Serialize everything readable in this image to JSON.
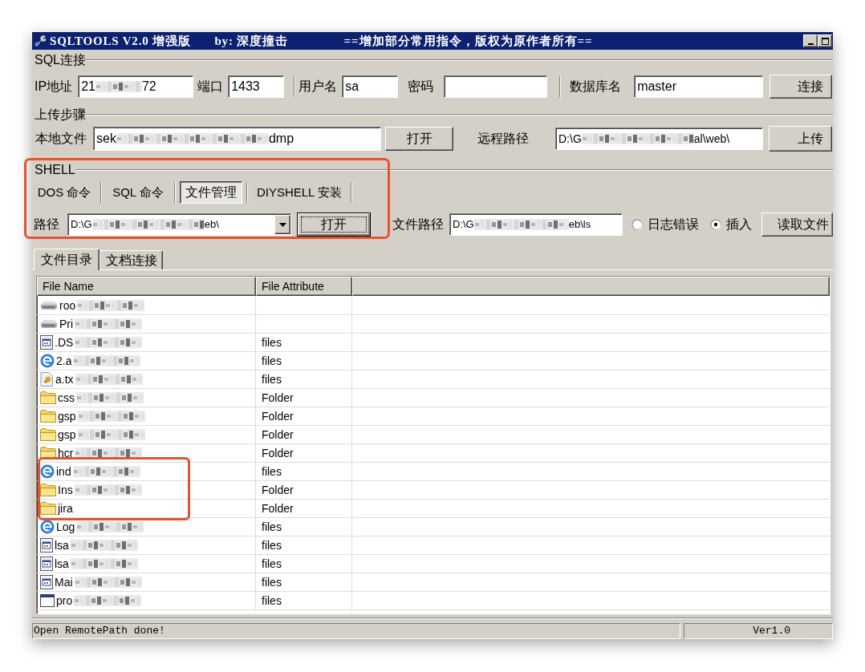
{
  "window": {
    "title": "SQLTOOLS V2.0 增强版",
    "author": "by: 深度撞击",
    "notice": "==增加部分常用指令，版权为原作者所有=="
  },
  "sql_connection": {
    "label": "SQL连接",
    "fields": [
      {
        "label": "IP地址",
        "value_parts": [
          "21",
          "72"
        ]
      },
      {
        "label": "端口",
        "value": "1433"
      },
      {
        "label": "用户名",
        "value": "sa"
      },
      {
        "label": "密码"
      },
      {
        "label": "数据库名",
        "value": "master"
      }
    ],
    "connect_button": "连接"
  },
  "upload": {
    "label": "上传步骤",
    "local_file": {
      "label": "本地文件",
      "value_parts": [
        "sek",
        "dmp"
      ]
    },
    "open_button": "打开",
    "remote_path": {
      "label": "远程路径",
      "value_parts": [
        "D:\\G",
        "al\\web\\"
      ]
    },
    "upload_button": "上传"
  },
  "shell": {
    "label": "SHELL",
    "highlighted": true,
    "modes": [
      {
        "label": "DOS 命令",
        "selected": false
      },
      {
        "label": "SQL 命令",
        "selected": false
      },
      {
        "label": "文件管理",
        "selected": true
      },
      {
        "label": "DIYSHELL 安装",
        "selected": false
      }
    ],
    "path": {
      "label": "路径",
      "value_parts": [
        "D:\\G",
        "eb\\"
      ]
    },
    "open_button": "打开",
    "file_path": {
      "label": "文件路径",
      "value_parts": [
        "D:\\G",
        "eb\\ls"
      ]
    },
    "options": [
      {
        "label": "日志错误",
        "selected": false
      },
      {
        "label": "插入",
        "selected": true
      }
    ],
    "read_button": "读取文件"
  },
  "tabs": [
    {
      "label": "文件目录",
      "selected": true
    },
    {
      "label": "文档连接",
      "selected": false
    }
  ],
  "file_list": {
    "columns": [
      "File Name",
      "File Attribute"
    ],
    "rows": [
      {
        "kind": "drive",
        "name": "roo",
        "redacted": true,
        "highlighted": false
      },
      {
        "kind": "drive",
        "name": "Pri",
        "redacted": true,
        "highlighted": false
      },
      {
        "kind": "settings-file",
        "name": ".DS",
        "redacted": true,
        "attribute": "files",
        "highlighted": false
      },
      {
        "kind": "web-page",
        "name": "2.a",
        "redacted": true,
        "attribute": "files",
        "highlighted": false
      },
      {
        "kind": "text-file",
        "name": "a.tx",
        "redacted": true,
        "attribute": "files",
        "highlighted": false
      },
      {
        "kind": "folder",
        "name": "css",
        "redacted": true,
        "attribute": "Folder",
        "highlighted": false
      },
      {
        "kind": "folder",
        "name": "gsp",
        "redacted": true,
        "attribute": "Folder",
        "highlighted": false
      },
      {
        "kind": "folder",
        "name": "gsp",
        "redacted": true,
        "attribute": "Folder",
        "highlighted": false
      },
      {
        "kind": "folder",
        "name": "hcr",
        "redacted": true,
        "attribute": "Folder",
        "highlighted": false
      },
      {
        "kind": "web-page",
        "name": "ind",
        "redacted": true,
        "attribute": "files",
        "highlighted": true
      },
      {
        "kind": "folder",
        "name": "Ins",
        "redacted": true,
        "attribute": "Folder",
        "highlighted": true
      },
      {
        "kind": "folder",
        "name": "jira",
        "redacted": false,
        "attribute": "Folder",
        "highlighted": true
      },
      {
        "kind": "web-page",
        "name": "Log",
        "redacted": true,
        "attribute": "files",
        "highlighted": false
      },
      {
        "kind": "settings-file",
        "name": "lsa",
        "redacted": true,
        "attribute": "files",
        "highlighted": false
      },
      {
        "kind": "settings-file",
        "name": "lsa",
        "redacted": true,
        "attribute": "files",
        "highlighted": false
      },
      {
        "kind": "settings-file",
        "name": "Mai",
        "redacted": true,
        "attribute": "files",
        "highlighted": false
      },
      {
        "kind": "program",
        "name": "pro",
        "redacted": true,
        "attribute": "files",
        "highlighted": false
      }
    ]
  },
  "status_bar": {
    "message": "Open RemotePath done!",
    "version": "Ver1.0"
  }
}
